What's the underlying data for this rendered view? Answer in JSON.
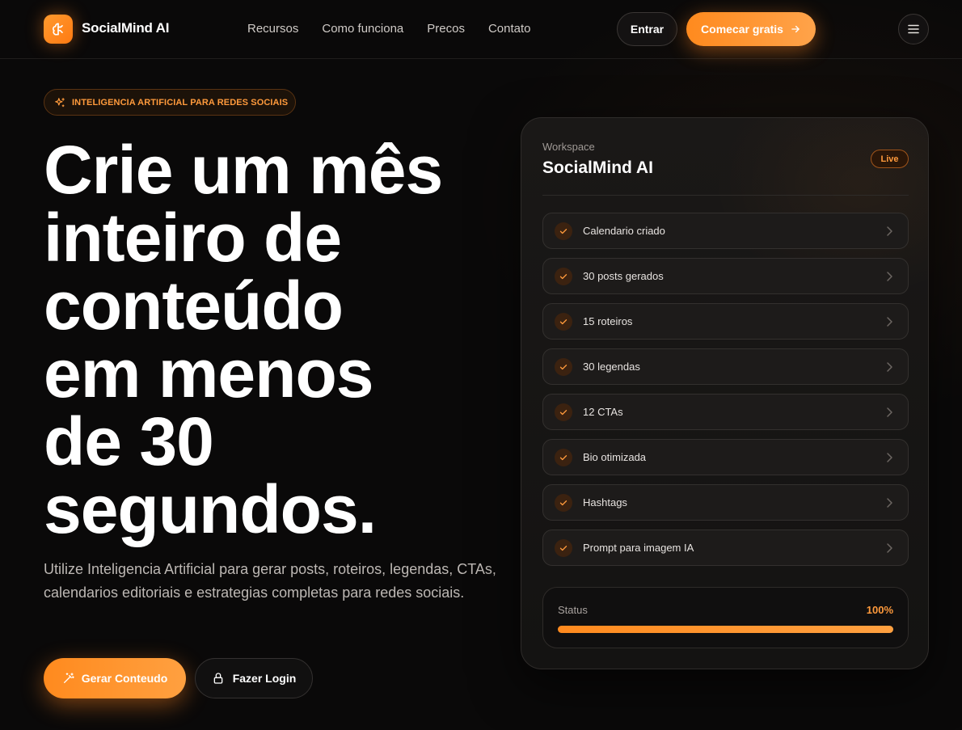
{
  "brand": {
    "name": "SocialMind AI",
    "accent": "#ff8a1e"
  },
  "nav": {
    "links": [
      "Recursos",
      "Como funciona",
      "Precos",
      "Contato"
    ],
    "login_label": "Entrar",
    "cta_label": "Comecar gratis"
  },
  "hero": {
    "badge": "INTELIGENCIA ARTIFICIAL PARA REDES SOCIAIS",
    "title_lines": [
      "Crie um mês",
      "inteiro de",
      "conteúdo",
      "em menos",
      "de 30",
      "segundos."
    ],
    "subtitle": "Utilize Inteligencia Artificial para gerar posts, roteiros, legendas, CTAs, calendarios editoriais e estrategias completas para redes sociais.",
    "primary_button": "Gerar Conteudo",
    "secondary_button": "Fazer Login"
  },
  "workspace": {
    "label": "Workspace",
    "title": "SocialMind AI",
    "badge": "Live",
    "items": [
      "Calendario criado",
      "30 posts gerados",
      "15 roteiros",
      "30 legendas",
      "12 CTAs",
      "Bio otimizada",
      "Hashtags",
      "Prompt para imagem IA"
    ],
    "status": {
      "label": "Status",
      "value_text": "100%",
      "progress": 1.0
    }
  }
}
